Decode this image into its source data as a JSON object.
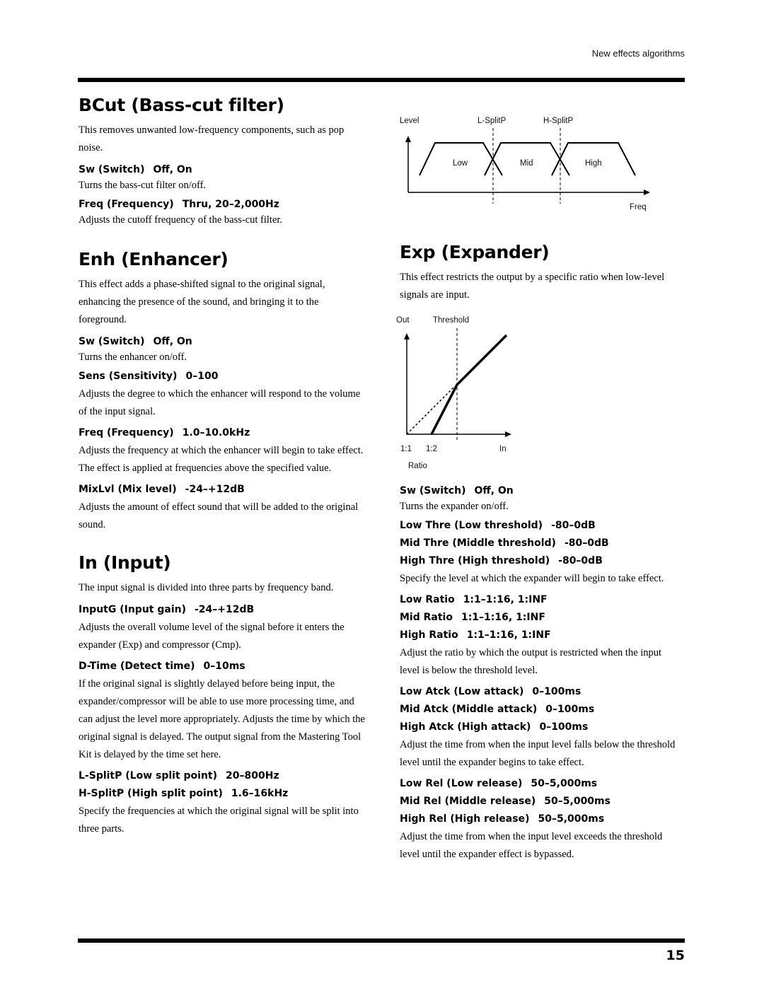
{
  "header": {
    "running_head": "New effects algorithms"
  },
  "footer": {
    "page_number": "15"
  },
  "left_column": {
    "bcut": {
      "title": "BCut (Bass-cut filter)",
      "intro": "This removes unwanted low-frequency components, such as pop noise.",
      "params": [
        {
          "name": "Sw (Switch)",
          "value": "Off, On",
          "desc": "Turns the bass-cut filter on/off."
        },
        {
          "name": "Freq (Frequency)",
          "value": "Thru, 20–2,000Hz",
          "desc": "Adjusts the cutoff frequency of the bass-cut filter."
        }
      ]
    },
    "enh": {
      "title": "Enh (Enhancer)",
      "intro": "This effect adds a phase-shifted signal to the original signal, enhancing the presence of the sound, and bringing it to the foreground.",
      "params": [
        {
          "name": "Sw (Switch)",
          "value": "Off, On",
          "desc": "Turns the enhancer on/off."
        },
        {
          "name": "Sens (Sensitivity)",
          "value": "0–100",
          "desc": "Adjusts the degree to which the enhancer will respond to the volume of the input signal."
        },
        {
          "name": "Freq (Frequency)",
          "value": "1.0–10.0kHz",
          "desc": "Adjusts the frequency at which the enhancer will begin to take effect. The effect is applied at frequencies above the specified value."
        },
        {
          "name": "MixLvl (Mix level)",
          "value": "-24–+12dB",
          "desc": "Adjusts the amount of effect sound that will be added to the original sound."
        }
      ]
    },
    "input": {
      "title": "In (Input)",
      "intro": "The input signal is divided into three parts by frequency band.",
      "params": [
        {
          "name": "InputG (Input gain)",
          "value": "-24–+12dB",
          "desc": "Adjusts the overall volume level of the signal before it enters the expander (Exp) and compressor (Cmp)."
        },
        {
          "name": "D-Time (Detect time)",
          "value": "0–10ms",
          "desc": "If the original signal is slightly delayed before being input, the expander/compressor will be able to use more processing time, and can adjust the level more appropriately. Adjusts the time by which the original signal is delayed. The output signal from the Mastering Tool Kit is delayed by the time set here."
        },
        {
          "name": "L-SplitP (Low split point)",
          "value": "20–800Hz"
        },
        {
          "name": "H-SplitP (High split point)",
          "value": "1.6–16kHz",
          "desc": "Specify the frequencies at which the original signal will be split into three parts."
        }
      ]
    }
  },
  "right_column": {
    "split_diagram": {
      "y_label": "Level",
      "x_label": "Freq",
      "markers": [
        "L-SplitP",
        "H-SplitP"
      ],
      "bands": [
        "Low",
        "Mid",
        "High"
      ]
    },
    "exp": {
      "title": "Exp (Expander)",
      "intro": "This effect restricts the output by a specific ratio when low-level signals are input.",
      "diagram": {
        "y_label": "Out",
        "x_label": "In",
        "threshold_label": "Threshold",
        "ratio_ticks": [
          "1:1",
          "1:2"
        ],
        "ratio_label": "Ratio"
      },
      "params": [
        {
          "lines": [
            {
              "name": "Sw (Switch)",
              "value": "Off, On"
            }
          ],
          "desc": "Turns the expander on/off."
        },
        {
          "lines": [
            {
              "name": "Low Thre (Low threshold)",
              "value": "-80–0dB"
            },
            {
              "name": "Mid Thre (Middle threshold)",
              "value": "-80–0dB"
            },
            {
              "name": "High Thre (High threshold)",
              "value": "-80–0dB"
            }
          ],
          "desc": "Specify the level at which the expander will begin to take effect."
        },
        {
          "lines": [
            {
              "name": "Low Ratio",
              "value": "1:1–1:16, 1:INF"
            },
            {
              "name": "Mid Ratio",
              "value": "1:1–1:16, 1:INF"
            },
            {
              "name": "High Ratio",
              "value": "1:1–1:16, 1:INF"
            }
          ],
          "desc": "Adjust the ratio by which the output is restricted when the input level is below the threshold level."
        },
        {
          "lines": [
            {
              "name": "Low Atck (Low attack)",
              "value": "0–100ms"
            },
            {
              "name": "Mid Atck (Middle attack)",
              "value": "0–100ms"
            },
            {
              "name": "High Atck (High attack)",
              "value": "0–100ms"
            }
          ],
          "desc": "Adjust the time from when the input level falls below the threshold level until the expander begins to take effect."
        },
        {
          "lines": [
            {
              "name": "Low Rel (Low release)",
              "value": "50–5,000ms"
            },
            {
              "name": "Mid Rel (Middle release)",
              "value": "50–5,000ms"
            },
            {
              "name": "High Rel (High release)",
              "value": "50–5,000ms"
            }
          ],
          "desc": "Adjust the time from when the input level exceeds the threshold level until the expander effect is bypassed."
        }
      ]
    }
  }
}
